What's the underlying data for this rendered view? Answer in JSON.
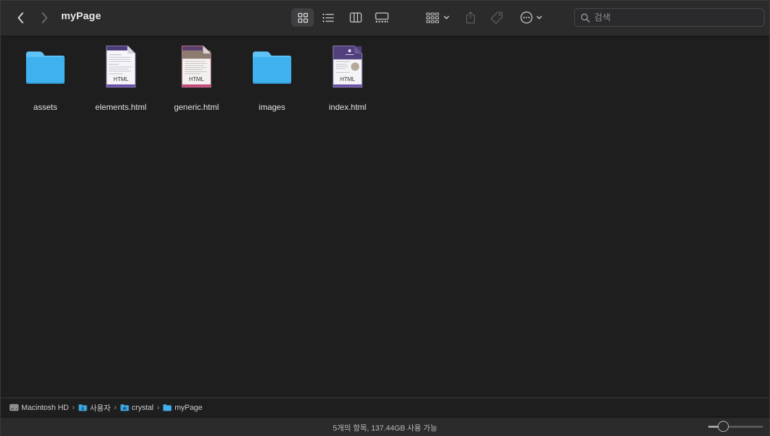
{
  "window": {
    "title": "myPage"
  },
  "toolbar": {
    "back_icon": "chevron-left-icon",
    "forward_icon": "chevron-right-icon",
    "views": [
      {
        "name": "icon-view",
        "active": true
      },
      {
        "name": "list-view",
        "active": false
      },
      {
        "name": "column-view",
        "active": false
      },
      {
        "name": "gallery-view",
        "active": false
      }
    ],
    "group_icon": "group-grid-icon",
    "share_icon": "share-icon",
    "tag_icon": "tag-icon",
    "more_icon": "ellipsis-circle-icon"
  },
  "search": {
    "placeholder": "검색",
    "value": ""
  },
  "files": [
    {
      "name": "assets",
      "kind": "folder"
    },
    {
      "name": "elements.html",
      "kind": "html",
      "badge": "HTML"
    },
    {
      "name": "generic.html",
      "kind": "html",
      "badge": "HTML"
    },
    {
      "name": "images",
      "kind": "folder"
    },
    {
      "name": "index.html",
      "kind": "html",
      "badge": "HTML"
    }
  ],
  "pathbar": {
    "crumbs": [
      "Macintosh HD",
      "사용자",
      "crystal",
      "myPage"
    ],
    "separator": "›"
  },
  "status": {
    "text": "5개의 항목, 137.44GB 사용 가능",
    "icon_size_level": 0.28
  },
  "colors": {
    "folder": "#3fb1ee",
    "folder_tab": "#5fc2f5",
    "accent_purple": "#5b3e8e"
  }
}
